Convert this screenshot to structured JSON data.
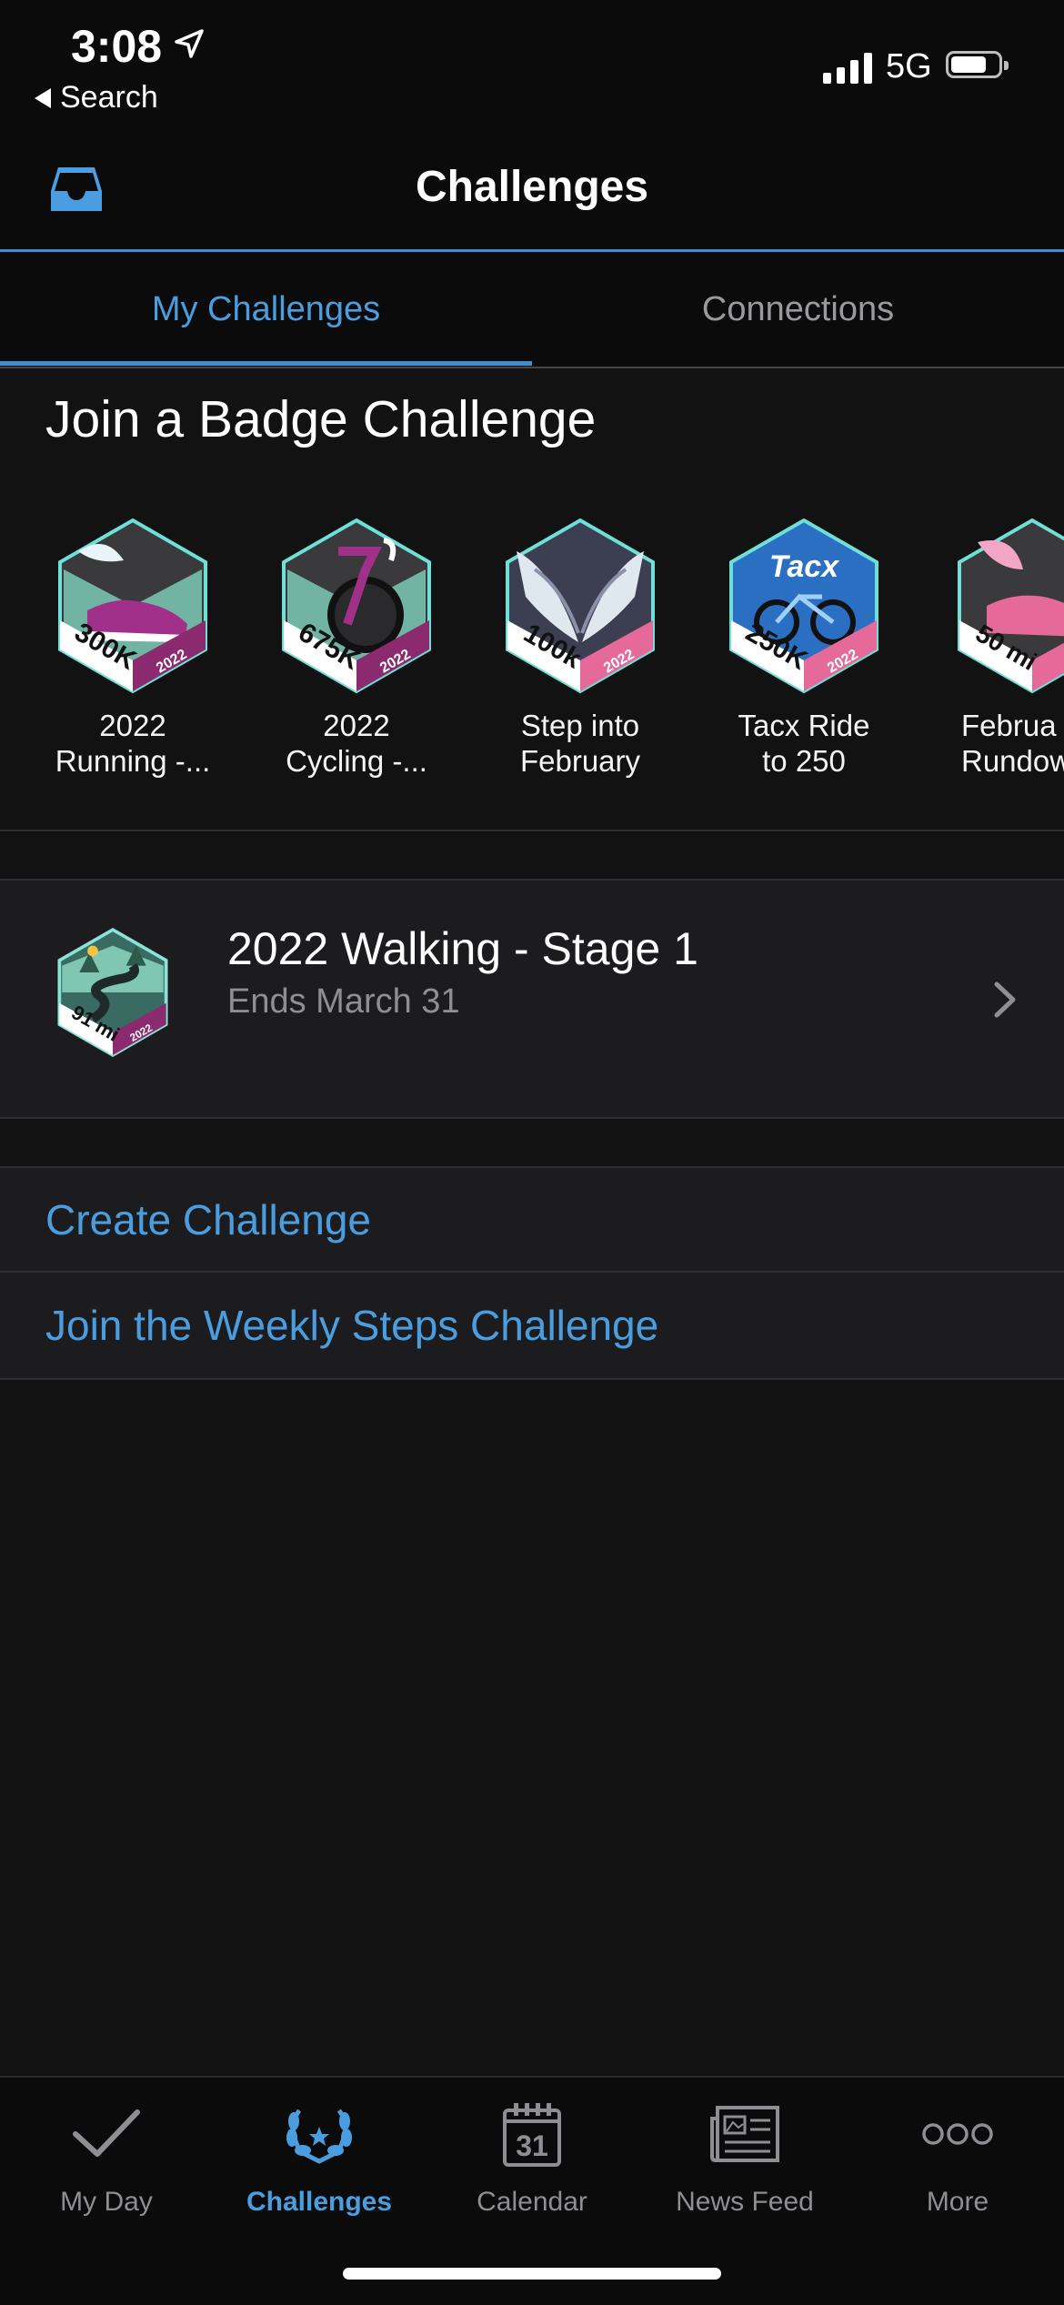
{
  "status_bar": {
    "time": "3:08",
    "back_label": "Search",
    "network": "5G"
  },
  "nav": {
    "title": "Challenges"
  },
  "tabs": [
    {
      "label": "My Challenges",
      "active": true
    },
    {
      "label": "Connections",
      "active": false
    }
  ],
  "badge_section": {
    "title": "Join a Badge Challenge",
    "badges": [
      {
        "line1": "2022",
        "line2": "Running -...",
        "badge_text": "300K",
        "year": "2022",
        "accent": "#8b2a6e"
      },
      {
        "line1": "2022",
        "line2": "Cycling -...",
        "badge_text": "675K",
        "year": "2022",
        "accent": "#8b2a6e"
      },
      {
        "line1": "Step into",
        "line2": "February",
        "badge_text": "100k",
        "year": "2022",
        "accent": "#e56a9a"
      },
      {
        "line1": "Tacx Ride",
        "line2": "to 250",
        "badge_text": "250K",
        "year": "2022",
        "brand": "Tacx",
        "accent": "#e56a9a"
      },
      {
        "line1": "Februa",
        "line2": "Rundow",
        "badge_text": "50 mi",
        "accent": "#e56a9a"
      }
    ]
  },
  "current_challenge": {
    "title": "2022 Walking - Stage 1",
    "subtitle": "Ends March 31",
    "badge_text": "91 mi",
    "year": "2022"
  },
  "links": {
    "create": "Create Challenge",
    "weekly": "Join the Weekly Steps Challenge"
  },
  "tabbar": [
    {
      "label": "My Day",
      "icon": "checkmark-icon",
      "active": false
    },
    {
      "label": "Challenges",
      "icon": "laurel-trophy-icon",
      "active": true
    },
    {
      "label": "Calendar",
      "icon": "calendar-icon",
      "active": false,
      "icon_text": "31"
    },
    {
      "label": "News Feed",
      "icon": "newspaper-icon",
      "active": false
    },
    {
      "label": "More",
      "icon": "more-icon",
      "active": false
    }
  ],
  "colors": {
    "accent": "#4a9ee0",
    "background": "#121213",
    "card": "#1c1c1e"
  }
}
